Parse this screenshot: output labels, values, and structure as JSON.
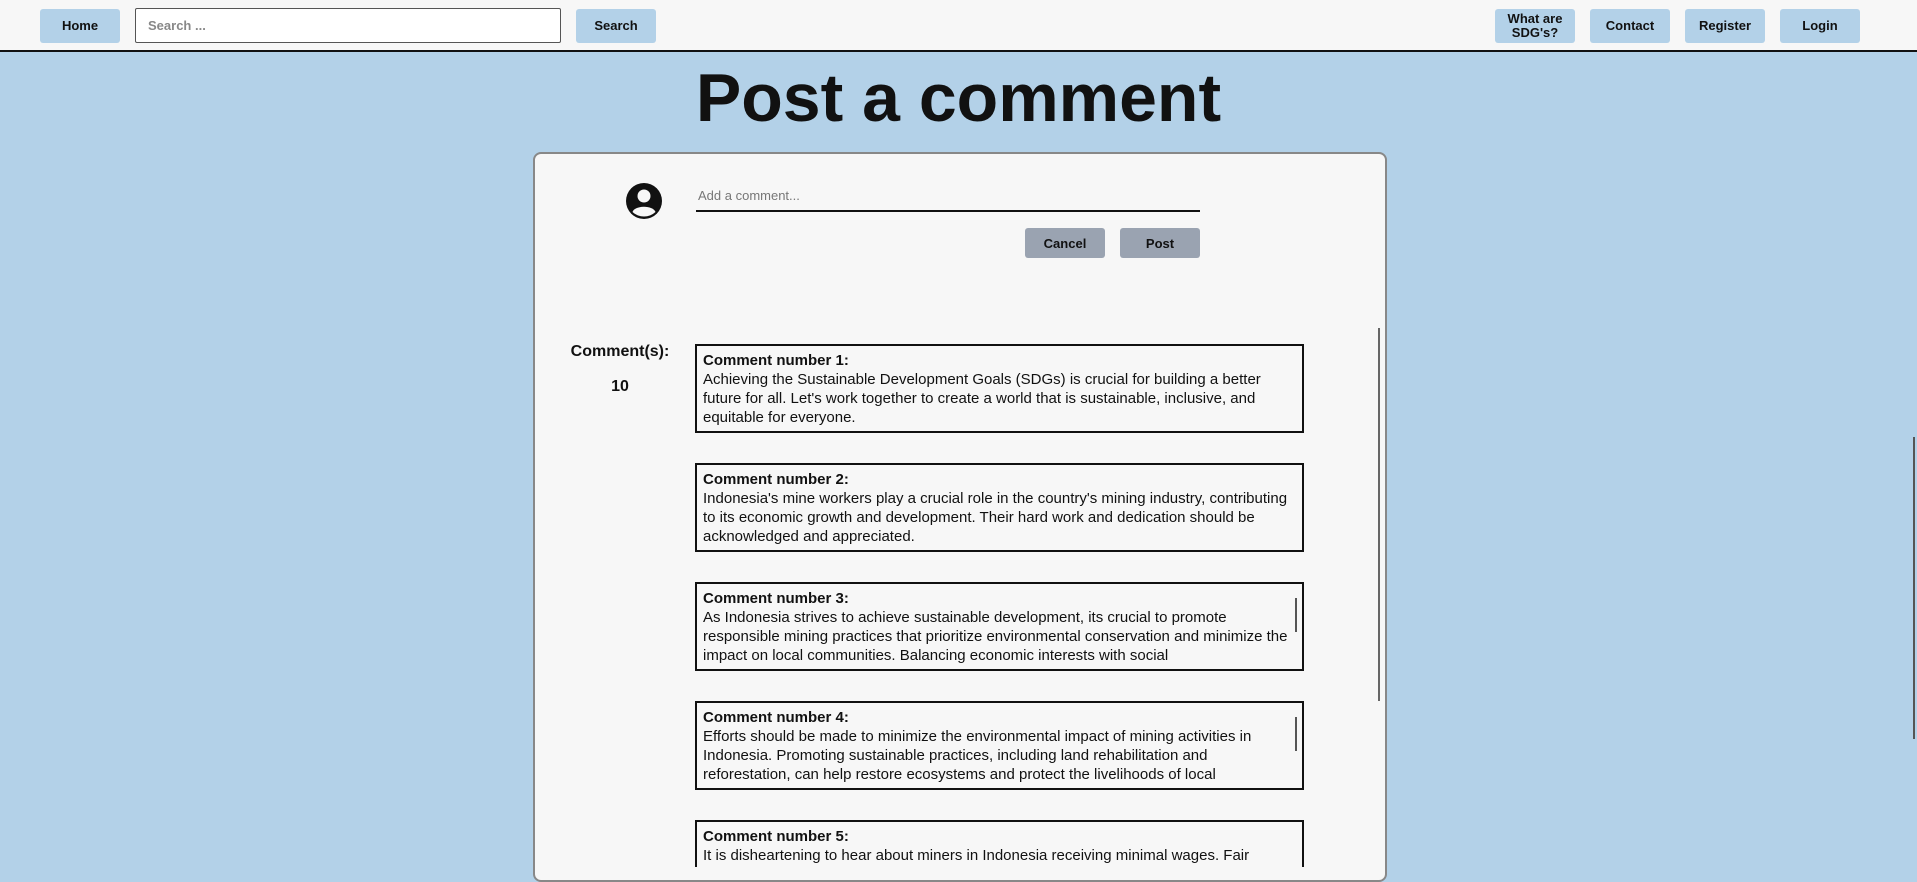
{
  "nav": {
    "home_label": "Home",
    "search_placeholder": "Search ...",
    "search_button_label": "Search",
    "sdg_label": "What are SDG's?",
    "contact_label": "Contact",
    "register_label": "Register",
    "login_label": "Login"
  },
  "page": {
    "title": "Post a comment"
  },
  "composer": {
    "placeholder": "Add a comment...",
    "cancel_label": "Cancel",
    "post_label": "Post",
    "avatar_icon": "user-circle-icon"
  },
  "comments": {
    "count_label": "Comment(s):",
    "count": "10",
    "items": [
      {
        "heading": "Comment number 1:",
        "text": "Achieving the Sustainable Development Goals (SDGs) is crucial for building a better future for all. Let's work together to create a world that is sustainable, inclusive, and equitable for everyone."
      },
      {
        "heading": "Comment number 2:",
        "text": "Indonesia's mine workers play a crucial role in the country's mining industry, contributing to its economic growth and development. Their hard work and dedication should be acknowledged and appreciated."
      },
      {
        "heading": "Comment number 3:",
        "text": "As Indonesia strives to achieve sustainable development, its crucial to promote responsible mining practices that prioritize environmental conservation and minimize the impact on local communities. Balancing economic interests with social"
      },
      {
        "heading": "Comment number 4:",
        "text": "Efforts should be made to minimize the environmental impact of mining activities in Indonesia. Promoting sustainable practices, including land rehabilitation and reforestation, can help restore ecosystems and protect the livelihoods of local"
      },
      {
        "heading": "Comment number 5:",
        "text": "It is disheartening to hear about miners in Indonesia receiving minimal wages. Fair"
      }
    ]
  }
}
